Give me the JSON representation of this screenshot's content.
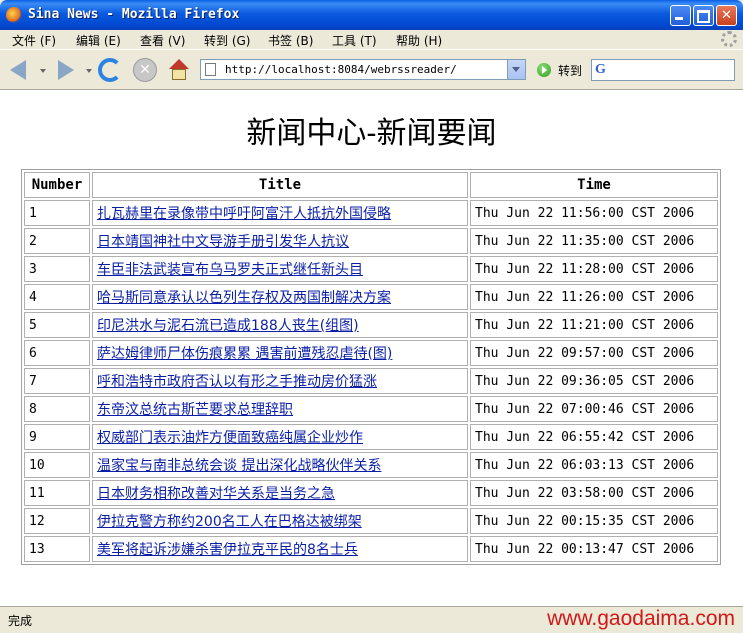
{
  "window": {
    "title": "Sina News - Mozilla Firefox"
  },
  "menu": {
    "items": [
      "文件 (F)",
      "编辑 (E)",
      "查看 (V)",
      "转到 (G)",
      "书签 (B)",
      "工具 (T)",
      "帮助 (H)"
    ]
  },
  "navbar": {
    "url": "http://localhost:8084/webrssreader/",
    "go_label": "转到"
  },
  "page": {
    "heading": "新闻中心-新闻要闻",
    "table": {
      "headers": [
        "Number",
        "Title",
        "Time"
      ],
      "rows": [
        {
          "number": "1",
          "title": "扎瓦赫里在录像带中呼吁阿富汗人抵抗外国侵略",
          "time": "Thu Jun 22 11:56:00 CST 2006"
        },
        {
          "number": "2",
          "title": "日本靖国神社中文导游手册引发华人抗议",
          "time": "Thu Jun 22 11:35:00 CST 2006"
        },
        {
          "number": "3",
          "title": "车臣非法武装宣布乌马罗夫正式继任新头目",
          "time": "Thu Jun 22 11:28:00 CST 2006"
        },
        {
          "number": "4",
          "title": "哈马斯同意承认以色列生存权及两国制解决方案",
          "time": "Thu Jun 22 11:26:00 CST 2006"
        },
        {
          "number": "5",
          "title": "印尼洪水与泥石流已造成188人丧生(组图)",
          "time": "Thu Jun 22 11:21:00 CST 2006"
        },
        {
          "number": "6",
          "title": "萨达姆律师尸体伤痕累累 遇害前遭残忍虐待(图)",
          "time": "Thu Jun 22 09:57:00 CST 2006"
        },
        {
          "number": "7",
          "title": "呼和浩特市政府否认以有形之手推动房价猛涨",
          "time": "Thu Jun 22 09:36:05 CST 2006"
        },
        {
          "number": "8",
          "title": "东帝汶总统古斯芒要求总理辞职",
          "time": "Thu Jun 22 07:00:46 CST 2006"
        },
        {
          "number": "9",
          "title": "权威部门表示油炸方便面致癌纯属企业炒作",
          "time": "Thu Jun 22 06:55:42 CST 2006"
        },
        {
          "number": "10",
          "title": "温家宝与南非总统会谈 提出深化战略伙伴关系",
          "time": "Thu Jun 22 06:03:13 CST 2006"
        },
        {
          "number": "11",
          "title": "日本财务相称改善对华关系是当务之急",
          "time": "Thu Jun 22 03:58:00 CST 2006"
        },
        {
          "number": "12",
          "title": "伊拉克警方称约200名工人在巴格达被绑架",
          "time": "Thu Jun 22 00:15:35 CST 2006"
        },
        {
          "number": "13",
          "title": "美军将起诉涉嫌杀害伊拉克平民的8名士兵",
          "time": "Thu Jun 22 00:13:47 CST 2006"
        }
      ]
    }
  },
  "status": {
    "text": "完成",
    "watermark": "www.gaodaima.com"
  },
  "icons": [
    "firefox-logo-icon",
    "back-icon",
    "forward-icon",
    "reload-icon",
    "stop-icon",
    "home-icon",
    "page-icon",
    "go-icon",
    "google-icon",
    "throbber-icon"
  ]
}
